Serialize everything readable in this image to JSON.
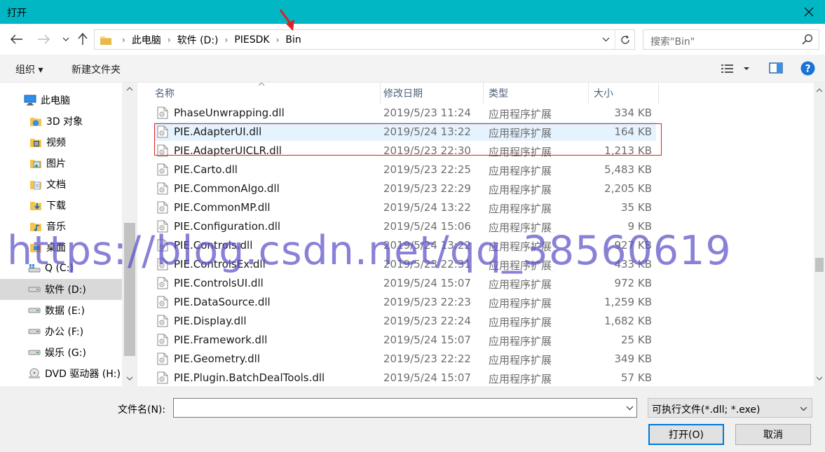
{
  "window": {
    "title": "打开"
  },
  "address": {
    "crumbs": [
      "此电脑",
      "软件 (D:)",
      "PIESDK",
      "Bin"
    ]
  },
  "search": {
    "placeholder": "搜索\"Bin\""
  },
  "toolbar": {
    "organize": "组织 ▾",
    "new_folder": "新建文件夹"
  },
  "sidebar": {
    "items": [
      {
        "label": "此电脑",
        "icon": "computer-icon"
      },
      {
        "label": "3D 对象",
        "icon": "3d-objects-icon"
      },
      {
        "label": "视频",
        "icon": "video-folder-icon"
      },
      {
        "label": "图片",
        "icon": "pictures-folder-icon"
      },
      {
        "label": "文档",
        "icon": "documents-folder-icon"
      },
      {
        "label": "下载",
        "icon": "downloads-folder-icon"
      },
      {
        "label": "音乐",
        "icon": "music-folder-icon"
      },
      {
        "label": "桌面",
        "icon": "desktop-folder-icon"
      },
      {
        "label": "Q (C:)",
        "icon": "windows-drive-icon"
      },
      {
        "label": "软件 (D:)",
        "icon": "drive-icon",
        "selected": true
      },
      {
        "label": "数据 (E:)",
        "icon": "drive-icon"
      },
      {
        "label": "办公 (F:)",
        "icon": "drive-icon"
      },
      {
        "label": "娱乐 (G:)",
        "icon": "drive-icon"
      },
      {
        "label": "DVD 驱动器 (H:)",
        "icon": "dvd-drive-icon"
      }
    ]
  },
  "columns": {
    "name": "名称",
    "date": "修改日期",
    "type": "类型",
    "size": "大小"
  },
  "files": [
    {
      "name": "PhaseUnwrapping.dll",
      "date": "2019/5/23 11:24",
      "type": "应用程序扩展",
      "size": "334 KB"
    },
    {
      "name": "PIE.AdapterUI.dll",
      "date": "2019/5/24 13:22",
      "type": "应用程序扩展",
      "size": "164 KB",
      "highlight": true
    },
    {
      "name": "PIE.AdapterUICLR.dll",
      "date": "2019/5/23 22:30",
      "type": "应用程序扩展",
      "size": "1,213 KB"
    },
    {
      "name": "PIE.Carto.dll",
      "date": "2019/5/23 22:25",
      "type": "应用程序扩展",
      "size": "5,483 KB"
    },
    {
      "name": "PIE.CommonAlgo.dll",
      "date": "2019/5/23 22:29",
      "type": "应用程序扩展",
      "size": "2,205 KB"
    },
    {
      "name": "PIE.CommonMP.dll",
      "date": "2019/5/24 13:22",
      "type": "应用程序扩展",
      "size": "35 KB"
    },
    {
      "name": "PIE.Configuration.dll",
      "date": "2019/5/24 15:06",
      "type": "应用程序扩展",
      "size": "9 KB"
    },
    {
      "name": "PIE.Controls.dll",
      "date": "2019/5/24 13:22",
      "type": "应用程序扩展",
      "size": "927 KB"
    },
    {
      "name": "PIE.ControlsEx.dll",
      "date": "2019/5/23 22:31",
      "type": "应用程序扩展",
      "size": "433 KB"
    },
    {
      "name": "PIE.ControlsUI.dll",
      "date": "2019/5/24 15:07",
      "type": "应用程序扩展",
      "size": "972 KB"
    },
    {
      "name": "PIE.DataSource.dll",
      "date": "2019/5/23 22:23",
      "type": "应用程序扩展",
      "size": "1,259 KB"
    },
    {
      "name": "PIE.Display.dll",
      "date": "2019/5/23 22:24",
      "type": "应用程序扩展",
      "size": "1,682 KB"
    },
    {
      "name": "PIE.Framework.dll",
      "date": "2019/5/24 15:07",
      "type": "应用程序扩展",
      "size": "25 KB"
    },
    {
      "name": "PIE.Geometry.dll",
      "date": "2019/5/23 22:22",
      "type": "应用程序扩展",
      "size": "349 KB"
    },
    {
      "name": "PIE.Plugin.BatchDealTools.dll",
      "date": "2019/5/24 15:07",
      "type": "应用程序扩展",
      "size": "57 KB"
    }
  ],
  "bottom": {
    "filename_label": "文件名(N):",
    "filename_value": "",
    "filetype": "可执行文件(*.dll; *.exe)",
    "open_button": "打开(O)",
    "cancel_button": "取消"
  },
  "watermark": "https://blog.csdn.net/qq_38560619",
  "colors": {
    "titlebar": "#00b7c3",
    "selection": "#e5f3ff",
    "annotation": "#e02020",
    "watermark": "#5a50c8"
  }
}
